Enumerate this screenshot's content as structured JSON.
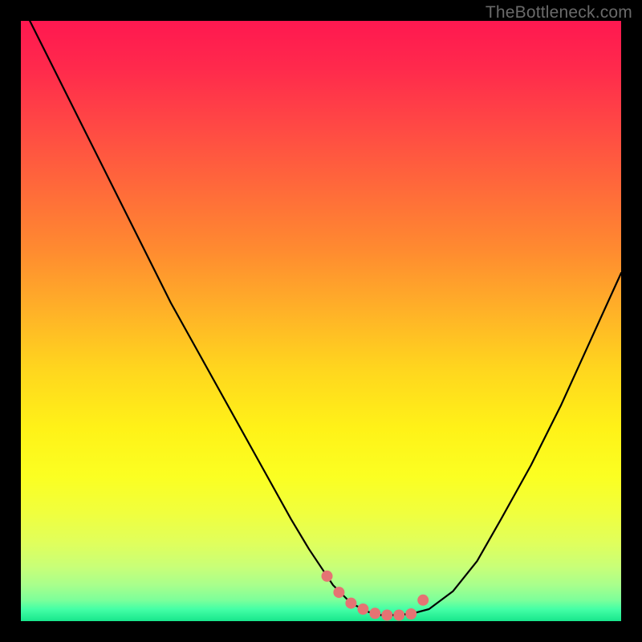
{
  "watermark": {
    "text": "TheBottleneck.com"
  },
  "colors": {
    "background": "#000000",
    "curve_stroke": "#000000",
    "marker_fill": "#e57373",
    "gradient_top": "#ff1850",
    "gradient_bottom": "#18e68c"
  },
  "chart_data": {
    "type": "line",
    "title": "",
    "xlabel": "",
    "ylabel": "",
    "xlim": [
      0,
      100
    ],
    "ylim": [
      0,
      100
    ],
    "grid": false,
    "series": [
      {
        "name": "bottleneck-curve",
        "x": [
          0,
          5,
          10,
          15,
          20,
          25,
          30,
          35,
          40,
          45,
          48,
          50,
          52,
          55,
          58,
          60,
          62,
          65,
          68,
          72,
          76,
          80,
          85,
          90,
          95,
          100
        ],
        "values": [
          103,
          93,
          83,
          73,
          63,
          53,
          44,
          35,
          26,
          17,
          12,
          9,
          6,
          3,
          1.5,
          1,
          1,
          1.2,
          2,
          5,
          10,
          17,
          26,
          36,
          47,
          58
        ]
      }
    ],
    "markers": {
      "name": "optimal-range",
      "x": [
        51,
        53,
        55,
        57,
        59,
        61,
        63,
        65,
        67
      ],
      "values": [
        7.5,
        4.8,
        3.0,
        2.0,
        1.3,
        1.0,
        1.0,
        1.2,
        3.5
      ]
    },
    "annotations": []
  }
}
